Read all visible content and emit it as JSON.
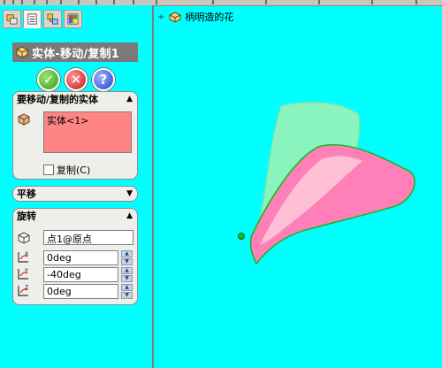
{
  "tabs": [
    {
      "name": "feature-manager",
      "icon": "feature-tree-icon"
    },
    {
      "name": "property-manager",
      "icon": "property-manager-icon"
    },
    {
      "name": "configuration-manager",
      "icon": "configuration-icon"
    },
    {
      "name": "appearance-manager",
      "icon": "appearance-icon"
    }
  ],
  "feature": {
    "title": "实体-移动/复制1",
    "icon": "move-copy-body-icon"
  },
  "actions": {
    "ok": "✓",
    "cancel": "✕",
    "help": "?"
  },
  "bodies_group": {
    "header": "要移动/复制的实体",
    "selected_items": [
      "实体<1>"
    ],
    "copy_label": "复制(C)",
    "copy_checked": false
  },
  "translate_group": {
    "header": "平移"
  },
  "rotate_group": {
    "header": "旋转",
    "reference": "点1@原点",
    "x_angle": "0deg",
    "y_angle": "-40deg",
    "z_angle": "0deg"
  },
  "tree": {
    "part_name": "柄明造的花"
  },
  "colors": {
    "background": "#00ffff",
    "selection_box": "#ff8484",
    "petal_pink": "#ff7fb8",
    "petal_ghost": "#b7f0a8",
    "edge_green": "#22b322"
  }
}
